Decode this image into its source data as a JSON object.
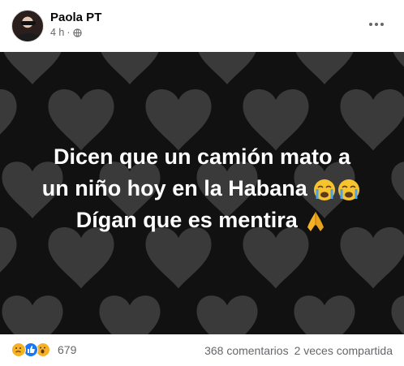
{
  "post": {
    "author": "Paola PT",
    "time": "4 h",
    "separator": "·",
    "privacy_icon": "globe-icon",
    "menu_icon": "more-dots-icon"
  },
  "image": {
    "background_color": "#111111",
    "heart_color": "#3a3a3a",
    "text_lines": [
      "Dicen que un camión mato a",
      "un niño hoy en la Habana",
      "Dígan que es mentira"
    ],
    "line2_emoji": "loudly-crying-face-icon",
    "line3_emoji": "folded-hands-icon"
  },
  "footer": {
    "reaction_icons": [
      "sad-reaction-icon",
      "like-reaction-icon",
      "wow-reaction-icon"
    ],
    "reaction_count": "679",
    "comments": "368 comentarios",
    "shares": "2 veces compartida"
  }
}
